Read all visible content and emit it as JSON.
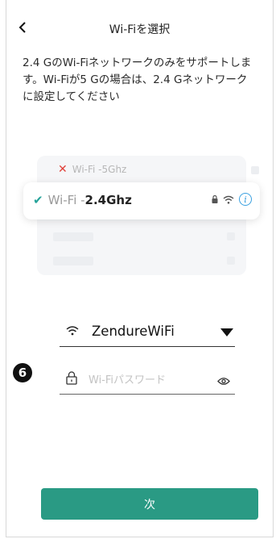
{
  "header": {
    "title": "Wi-Fiを選択",
    "back_icon": "chevron-left-icon"
  },
  "description": "2.4 GのWi-Fiネットワークのみをサポートします。Wi-Fiが5 Gの場合は、2.4 Gネットワークに設定してください",
  "illustration": {
    "row_5g": {
      "prefix": "Wi-Fi - ",
      "band": "5Ghz",
      "status_icon": "x-icon"
    },
    "row_24g": {
      "prefix": "Wi-Fi - ",
      "band": "2.4Ghz",
      "status_icon": "check-icon"
    }
  },
  "form": {
    "ssid": "ZendureWiFi",
    "password_placeholder": "Wi-Fiパスワード",
    "step_badge": "6"
  },
  "next_button": {
    "label": "次"
  },
  "colors": {
    "accent": "#2a9a84",
    "check": "#26a39a",
    "error": "#e0413a",
    "info": "#3aa0e0"
  }
}
